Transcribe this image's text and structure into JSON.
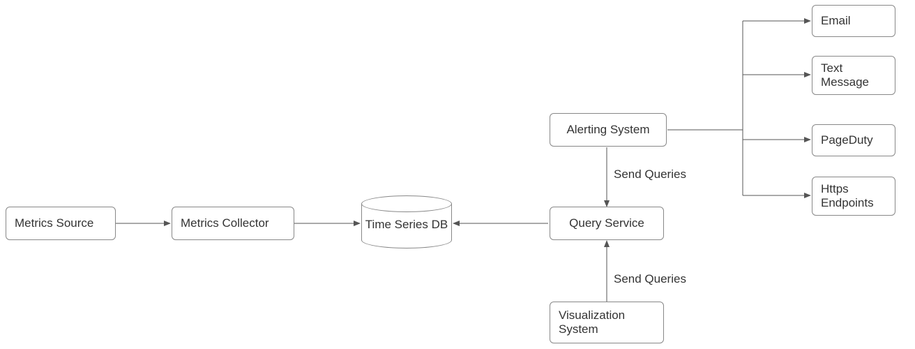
{
  "nodes": {
    "metricsSource": "Metrics Source",
    "metricsCollector": "Metrics Collector",
    "timeSeriesDb": "Time Series DB",
    "queryService": "Query Service",
    "alertingSystem": "Alerting System",
    "visualizationSystem": "Visualization\nSystem",
    "email": "Email",
    "textMessage": "Text\nMessage",
    "pageDuty": "PageDuty",
    "httpsEndpoints": "Https\nEndpoints"
  },
  "edges": {
    "sendQueries1": "Send Queries",
    "sendQueries2": "Send Queries"
  },
  "layout": {
    "description": "Architecture diagram showing: Metrics Source -> Metrics Collector -> Time Series DB <- Query Service. Query Service receives Send Queries from Alerting System (above) and Visualization System (below). Alerting System fan-outs to Email, Text Message, PageDuty, Https Endpoints."
  }
}
